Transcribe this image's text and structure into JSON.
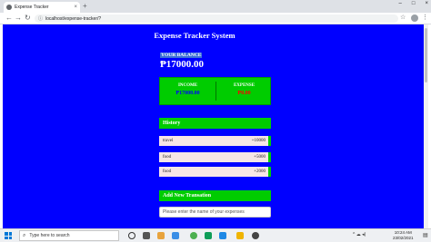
{
  "browser": {
    "tab_title": "Expense Tracker",
    "tab_close": "×",
    "new_tab": "+",
    "url": "localhost/expense-tracker/?",
    "back": "←",
    "forward": "→",
    "reload": "↻",
    "info": "ⓘ",
    "star": "☆",
    "menu": "⋮",
    "window_controls": [
      "–",
      "□",
      "×"
    ]
  },
  "app": {
    "title": "Expense Tracker System",
    "balance_label": "YOUR BALANCE",
    "balance_amount": "₱17000.00",
    "income_label": "INCOME",
    "income_value": "₱17000.00",
    "expense_label": "EXPENSE",
    "expense_value": "₱0.00",
    "history_title": "History",
    "history": [
      {
        "name": "travel",
        "amount": "+10000"
      },
      {
        "name": "food",
        "amount": "+5000"
      },
      {
        "name": "food",
        "amount": "+2000"
      }
    ],
    "add_title": "Add New Transation",
    "expense_placeholder": "Please enter the name of your expenses"
  },
  "taskbar": {
    "search_placeholder": "Type here to search",
    "search_icon": "⌕",
    "time": "10:24 AM",
    "date": "23/02/2021",
    "notify_icon": "▤",
    "tray": "^ ☁ ◂)"
  },
  "colors": {
    "page_bg": "#0000ff",
    "accent_green": "#00cc00",
    "income_value": "#0000ff",
    "expense_value": "#ff0000",
    "history_row_bg": "#f6e6e6"
  }
}
